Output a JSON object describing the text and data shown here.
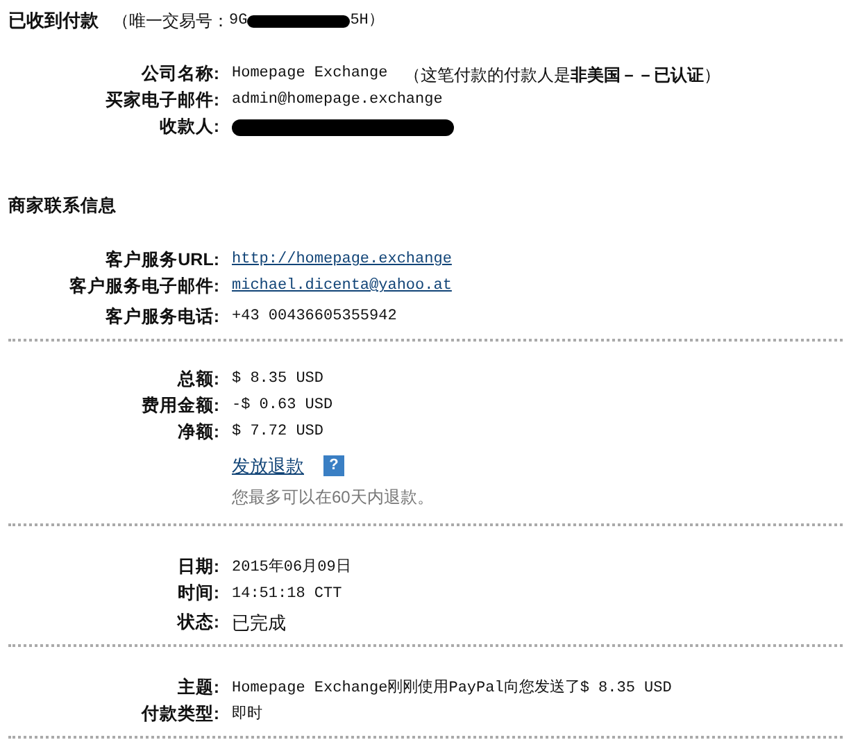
{
  "header": {
    "title": "已收到付款",
    "transaction_label": "（唯一交易号：",
    "transaction_start": "9G",
    "transaction_end": "5H）"
  },
  "payer": [
    {
      "label": "公司名称:",
      "value": "Homepage Exchange",
      "note": "（这笔付款的付款人是**非美国－－已认证**）"
    },
    {
      "label": "买家电子邮件:",
      "value": "admin@homepage.exchange"
    },
    {
      "label": "收款人:",
      "redacted": true
    }
  ],
  "merchant": {
    "title": "商家联系信息",
    "rows": [
      {
        "label": "客户服务URL:",
        "value": "http://homepage.exchange",
        "kind": "link"
      },
      {
        "label": "客户服务电子邮件:",
        "value": "michael.dicenta@yahoo.at",
        "kind": "link"
      },
      {
        "label": "客户服务电话:",
        "value": "+43 00436605355942",
        "kind": "text"
      }
    ]
  },
  "amounts": [
    {
      "label": "总额:",
      "value": "$ 8.35 USD"
    },
    {
      "label": "费用金额:",
      "value": "-$ 0.63 USD"
    },
    {
      "label": "净额:",
      "value": "$ 7.72 USD"
    }
  ],
  "refund": {
    "link": "发放退款",
    "help": "?",
    "note": "您最多可以在60天内退款。"
  },
  "details": [
    {
      "label": "日期:",
      "value": "2015年06月09日"
    },
    {
      "label": "时间:",
      "value": "14:51:18 CTT"
    },
    {
      "label": "状态:",
      "value": "已完成"
    }
  ],
  "payment": [
    {
      "label": "主题:",
      "value": "Homepage Exchange刚刚使用PayPal向您发送了$ 8.35 USD"
    },
    {
      "label": "付款类型:",
      "value": "即时"
    }
  ]
}
